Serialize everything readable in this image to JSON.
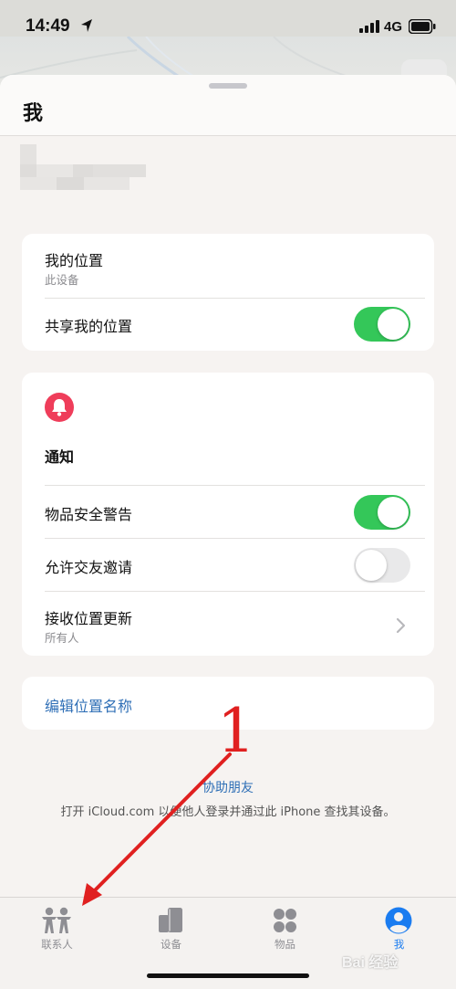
{
  "status_bar": {
    "time": "14:49",
    "network": "4G"
  },
  "sheet": {
    "title": "我"
  },
  "location_card": {
    "my_location_label": "我的位置",
    "my_location_sub": "此设备",
    "share_label": "共享我的位置",
    "share_on": true
  },
  "notifications_card": {
    "section_title": "通知",
    "icon": "bell-icon",
    "items": [
      {
        "label": "物品安全警告",
        "toggle": "on"
      },
      {
        "label": "允许交友邀请",
        "toggle": "off"
      }
    ],
    "receive_updates_label": "接收位置更新",
    "receive_updates_sub": "所有人"
  },
  "edit_card": {
    "edit_name_label": "编辑位置名称"
  },
  "footer": {
    "help_link": "协助朋友",
    "note": "打开 iCloud.com 以便他人登录并通过此 iPhone 查找其设备。"
  },
  "tabs": [
    {
      "label": "联系人",
      "icon": "people-icon",
      "active": false
    },
    {
      "label": "设备",
      "icon": "devices-icon",
      "active": false
    },
    {
      "label": "物品",
      "icon": "items-icon",
      "active": false
    },
    {
      "label": "我",
      "icon": "person-circle-icon",
      "active": true
    }
  ],
  "annotation": {
    "number": "1"
  },
  "watermark": {
    "text": "Bai 经验"
  },
  "colors": {
    "toggle_on": "#34c759",
    "toggle_off": "#e9e9ea",
    "link": "#2f6fb6",
    "active_tab": "#1a7cf0",
    "bell_badge": "#ef3d5a",
    "annotation": "#e02020"
  }
}
